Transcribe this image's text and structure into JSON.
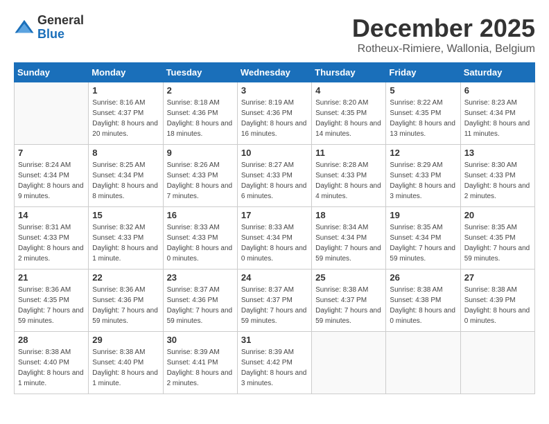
{
  "header": {
    "logo_general": "General",
    "logo_blue": "Blue",
    "month_title": "December 2025",
    "location": "Rotheux-Rimiere, Wallonia, Belgium"
  },
  "weekdays": [
    "Sunday",
    "Monday",
    "Tuesday",
    "Wednesday",
    "Thursday",
    "Friday",
    "Saturday"
  ],
  "weeks": [
    [
      {
        "day": "",
        "sunrise": "",
        "sunset": "",
        "daylight": ""
      },
      {
        "day": "1",
        "sunrise": "Sunrise: 8:16 AM",
        "sunset": "Sunset: 4:37 PM",
        "daylight": "Daylight: 8 hours and 20 minutes."
      },
      {
        "day": "2",
        "sunrise": "Sunrise: 8:18 AM",
        "sunset": "Sunset: 4:36 PM",
        "daylight": "Daylight: 8 hours and 18 minutes."
      },
      {
        "day": "3",
        "sunrise": "Sunrise: 8:19 AM",
        "sunset": "Sunset: 4:36 PM",
        "daylight": "Daylight: 8 hours and 16 minutes."
      },
      {
        "day": "4",
        "sunrise": "Sunrise: 8:20 AM",
        "sunset": "Sunset: 4:35 PM",
        "daylight": "Daylight: 8 hours and 14 minutes."
      },
      {
        "day": "5",
        "sunrise": "Sunrise: 8:22 AM",
        "sunset": "Sunset: 4:35 PM",
        "daylight": "Daylight: 8 hours and 13 minutes."
      },
      {
        "day": "6",
        "sunrise": "Sunrise: 8:23 AM",
        "sunset": "Sunset: 4:34 PM",
        "daylight": "Daylight: 8 hours and 11 minutes."
      }
    ],
    [
      {
        "day": "7",
        "sunrise": "Sunrise: 8:24 AM",
        "sunset": "Sunset: 4:34 PM",
        "daylight": "Daylight: 8 hours and 9 minutes."
      },
      {
        "day": "8",
        "sunrise": "Sunrise: 8:25 AM",
        "sunset": "Sunset: 4:34 PM",
        "daylight": "Daylight: 8 hours and 8 minutes."
      },
      {
        "day": "9",
        "sunrise": "Sunrise: 8:26 AM",
        "sunset": "Sunset: 4:33 PM",
        "daylight": "Daylight: 8 hours and 7 minutes."
      },
      {
        "day": "10",
        "sunrise": "Sunrise: 8:27 AM",
        "sunset": "Sunset: 4:33 PM",
        "daylight": "Daylight: 8 hours and 6 minutes."
      },
      {
        "day": "11",
        "sunrise": "Sunrise: 8:28 AM",
        "sunset": "Sunset: 4:33 PM",
        "daylight": "Daylight: 8 hours and 4 minutes."
      },
      {
        "day": "12",
        "sunrise": "Sunrise: 8:29 AM",
        "sunset": "Sunset: 4:33 PM",
        "daylight": "Daylight: 8 hours and 3 minutes."
      },
      {
        "day": "13",
        "sunrise": "Sunrise: 8:30 AM",
        "sunset": "Sunset: 4:33 PM",
        "daylight": "Daylight: 8 hours and 2 minutes."
      }
    ],
    [
      {
        "day": "14",
        "sunrise": "Sunrise: 8:31 AM",
        "sunset": "Sunset: 4:33 PM",
        "daylight": "Daylight: 8 hours and 2 minutes."
      },
      {
        "day": "15",
        "sunrise": "Sunrise: 8:32 AM",
        "sunset": "Sunset: 4:33 PM",
        "daylight": "Daylight: 8 hours and 1 minute."
      },
      {
        "day": "16",
        "sunrise": "Sunrise: 8:33 AM",
        "sunset": "Sunset: 4:33 PM",
        "daylight": "Daylight: 8 hours and 0 minutes."
      },
      {
        "day": "17",
        "sunrise": "Sunrise: 8:33 AM",
        "sunset": "Sunset: 4:34 PM",
        "daylight": "Daylight: 8 hours and 0 minutes."
      },
      {
        "day": "18",
        "sunrise": "Sunrise: 8:34 AM",
        "sunset": "Sunset: 4:34 PM",
        "daylight": "Daylight: 7 hours and 59 minutes."
      },
      {
        "day": "19",
        "sunrise": "Sunrise: 8:35 AM",
        "sunset": "Sunset: 4:34 PM",
        "daylight": "Daylight: 7 hours and 59 minutes."
      },
      {
        "day": "20",
        "sunrise": "Sunrise: 8:35 AM",
        "sunset": "Sunset: 4:35 PM",
        "daylight": "Daylight: 7 hours and 59 minutes."
      }
    ],
    [
      {
        "day": "21",
        "sunrise": "Sunrise: 8:36 AM",
        "sunset": "Sunset: 4:35 PM",
        "daylight": "Daylight: 7 hours and 59 minutes."
      },
      {
        "day": "22",
        "sunrise": "Sunrise: 8:36 AM",
        "sunset": "Sunset: 4:36 PM",
        "daylight": "Daylight: 7 hours and 59 minutes."
      },
      {
        "day": "23",
        "sunrise": "Sunrise: 8:37 AM",
        "sunset": "Sunset: 4:36 PM",
        "daylight": "Daylight: 7 hours and 59 minutes."
      },
      {
        "day": "24",
        "sunrise": "Sunrise: 8:37 AM",
        "sunset": "Sunset: 4:37 PM",
        "daylight": "Daylight: 7 hours and 59 minutes."
      },
      {
        "day": "25",
        "sunrise": "Sunrise: 8:38 AM",
        "sunset": "Sunset: 4:37 PM",
        "daylight": "Daylight: 7 hours and 59 minutes."
      },
      {
        "day": "26",
        "sunrise": "Sunrise: 8:38 AM",
        "sunset": "Sunset: 4:38 PM",
        "daylight": "Daylight: 8 hours and 0 minutes."
      },
      {
        "day": "27",
        "sunrise": "Sunrise: 8:38 AM",
        "sunset": "Sunset: 4:39 PM",
        "daylight": "Daylight: 8 hours and 0 minutes."
      }
    ],
    [
      {
        "day": "28",
        "sunrise": "Sunrise: 8:38 AM",
        "sunset": "Sunset: 4:40 PM",
        "daylight": "Daylight: 8 hours and 1 minute."
      },
      {
        "day": "29",
        "sunrise": "Sunrise: 8:38 AM",
        "sunset": "Sunset: 4:40 PM",
        "daylight": "Daylight: 8 hours and 1 minute."
      },
      {
        "day": "30",
        "sunrise": "Sunrise: 8:39 AM",
        "sunset": "Sunset: 4:41 PM",
        "daylight": "Daylight: 8 hours and 2 minutes."
      },
      {
        "day": "31",
        "sunrise": "Sunrise: 8:39 AM",
        "sunset": "Sunset: 4:42 PM",
        "daylight": "Daylight: 8 hours and 3 minutes."
      },
      {
        "day": "",
        "sunrise": "",
        "sunset": "",
        "daylight": ""
      },
      {
        "day": "",
        "sunrise": "",
        "sunset": "",
        "daylight": ""
      },
      {
        "day": "",
        "sunrise": "",
        "sunset": "",
        "daylight": ""
      }
    ]
  ]
}
